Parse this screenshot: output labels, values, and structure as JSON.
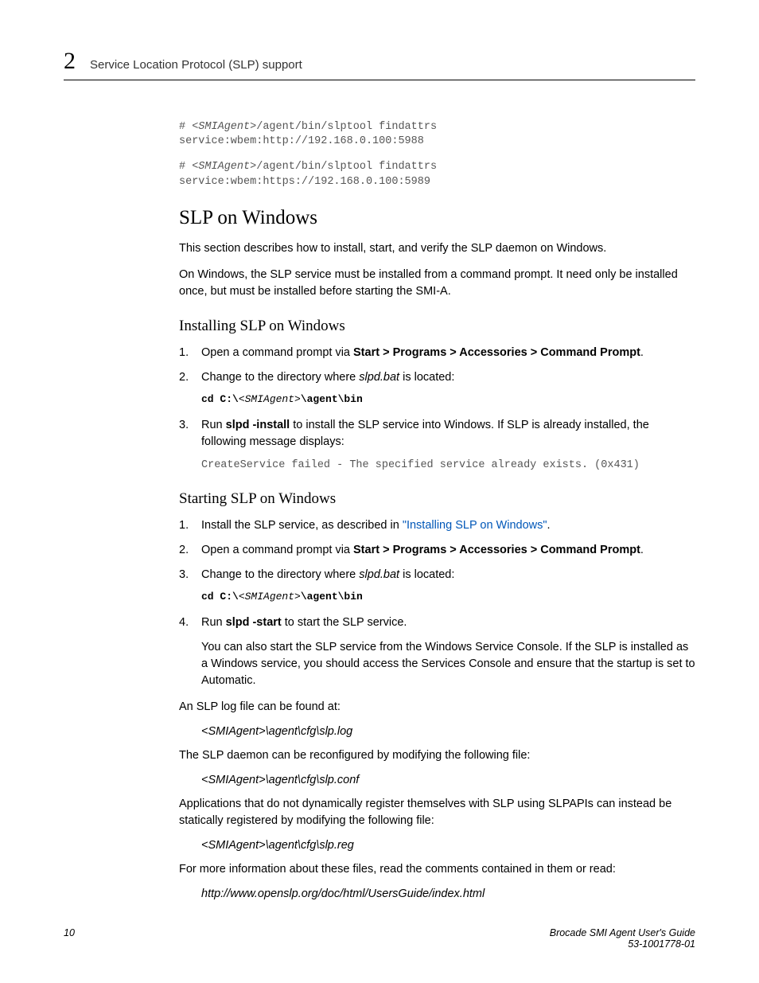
{
  "header": {
    "chapter": "2",
    "title": "Service Location Protocol (SLP) support"
  },
  "code1": {
    "line1_prefix": "# ",
    "line1_italic": "<SMIAgent>",
    "line1_suffix": "/agent/bin/slptool findattrs",
    "line2": "service:wbem:http://192.168.0.100:5988"
  },
  "code2": {
    "line1_prefix": "# ",
    "line1_italic": "<SMIAgent>",
    "line1_suffix": "/agent/bin/slptool findattrs",
    "line2": "service:wbem:https://192.168.0.100:5989"
  },
  "h2_1": "SLP on Windows",
  "p1": "This section describes how to install, start, and verify the SLP daemon on Windows.",
  "p2": "On Windows, the SLP service must be installed from a command prompt. It need only be installed once, but must be installed before starting the SMI-A.",
  "h3_1": "Installing SLP on Windows",
  "install": {
    "step1_a": "Open a command prompt via ",
    "step1_b": "Start > Programs > Accessories > Command Prompt",
    "step1_c": ".",
    "step2_a": "Change to the directory where ",
    "step2_b": "slpd.bat",
    "step2_c": " is located:",
    "step2_code_a": "cd C:\\",
    "step2_code_b": "<SMIAgent>",
    "step2_code_c": "\\agent\\bin",
    "step3_a": "Run ",
    "step3_b": "slpd -install",
    "step3_c": " to install the SLP service into Windows. If SLP is already installed, the following message displays:",
    "step3_code": "CreateService failed - The specified service already exists. (0x431)"
  },
  "h3_2": "Starting SLP on Windows",
  "start": {
    "step1_a": "Install the SLP service, as described in ",
    "step1_link": "\"Installing SLP on Windows\"",
    "step1_c": ".",
    "step2_a": "Open a command prompt via ",
    "step2_b": "Start > Programs > Accessories > Command Prompt",
    "step2_c": ".",
    "step3_a": "Change to the directory where ",
    "step3_b": "slpd.bat",
    "step3_c": " is located:",
    "step3_code_a": "cd C:\\",
    "step3_code_b": "<SMIAgent>",
    "step3_code_c": "\\agent\\bin",
    "step4_a": "Run ",
    "step4_b": "slpd -start",
    "step4_c": " to start the SLP service.",
    "step4_p": "You can also start the SLP service from the Windows Service Console. If the SLP is installed as a Windows service, you should access the Services Console and ensure that the startup is set to Automatic."
  },
  "p_log": "An SLP log file can be found at:",
  "path_log": "<SMIAgent>\\agent\\cfg\\slp.log",
  "p_conf": "The SLP daemon can be reconfigured by modifying the following file:",
  "path_conf": "<SMIAgent>\\agent\\cfg\\slp.conf",
  "p_reg": "Applications that do not dynamically register themselves with SLP using SLPAPIs can instead be statically registered by modifying the following file:",
  "path_reg": "<SMIAgent>\\agent\\cfg\\slp.reg",
  "p_info": "For more information about these files, read the comments contained in them or read:",
  "path_url": "http://www.openslp.org/doc/html/UsersGuide/index.html",
  "footer": {
    "page": "10",
    "title": "Brocade SMI Agent User's Guide",
    "docnum": "53-1001778-01"
  }
}
